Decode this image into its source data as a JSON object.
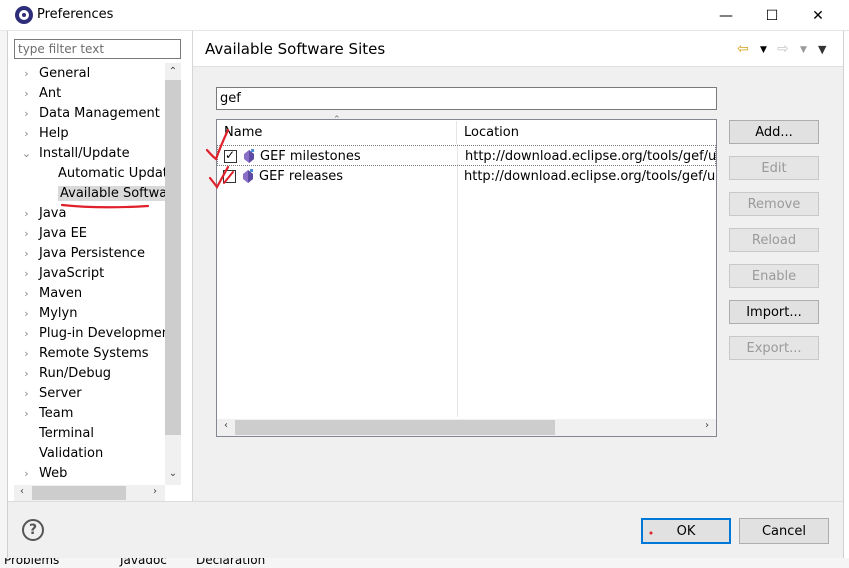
{
  "window": {
    "title": "Preferences",
    "minimize_glyph": "—",
    "maximize_glyph": "☐",
    "close_glyph": "✕"
  },
  "sidebar": {
    "filter_placeholder": "type filter text",
    "items": [
      {
        "label": "General",
        "expandable": true
      },
      {
        "label": "Ant",
        "expandable": true
      },
      {
        "label": "Data Management",
        "expandable": true
      },
      {
        "label": "Help",
        "expandable": true
      },
      {
        "label": "Install/Update",
        "expandable": true,
        "expanded": true
      },
      {
        "label": "Automatic Update",
        "child": true
      },
      {
        "label": "Available Software",
        "child": true,
        "selected": true
      },
      {
        "label": "Java",
        "expandable": true
      },
      {
        "label": "Java EE",
        "expandable": true
      },
      {
        "label": "Java Persistence",
        "expandable": true
      },
      {
        "label": "JavaScript",
        "expandable": true
      },
      {
        "label": "Maven",
        "expandable": true
      },
      {
        "label": "Mylyn",
        "expandable": true
      },
      {
        "label": "Plug-in Development",
        "expandable": true
      },
      {
        "label": "Remote Systems",
        "expandable": true
      },
      {
        "label": "Run/Debug",
        "expandable": true
      },
      {
        "label": "Server",
        "expandable": true
      },
      {
        "label": "Team",
        "expandable": true
      },
      {
        "label": "Terminal",
        "expandable": false
      },
      {
        "label": "Validation",
        "expandable": false
      },
      {
        "label": "Web",
        "expandable": true
      }
    ]
  },
  "page": {
    "title": "Available Software Sites",
    "search_value": "gef",
    "columns": {
      "name": "Name",
      "location": "Location"
    },
    "rows": [
      {
        "checked": true,
        "name": "GEF milestones",
        "location": "http://download.eclipse.org/tools/gef/updates/milestones"
      },
      {
        "checked": false,
        "name": "GEF releases",
        "location": "http://download.eclipse.org/tools/gef/updates/releases"
      }
    ],
    "buttons": {
      "add": "Add...",
      "edit": "Edit",
      "remove": "Remove",
      "reload": "Reload",
      "enable": "Enable",
      "import": "Import...",
      "export": "Export..."
    }
  },
  "footer": {
    "help_glyph": "?",
    "ok": "OK",
    "cancel": "Cancel"
  },
  "background_window": {
    "tab_problems": "Problems",
    "tab_javadoc": "Javadoc",
    "tab_declaration": "Declaration"
  },
  "colors": {
    "accent": "#0078d7",
    "annotation_red": "#e0202a"
  }
}
